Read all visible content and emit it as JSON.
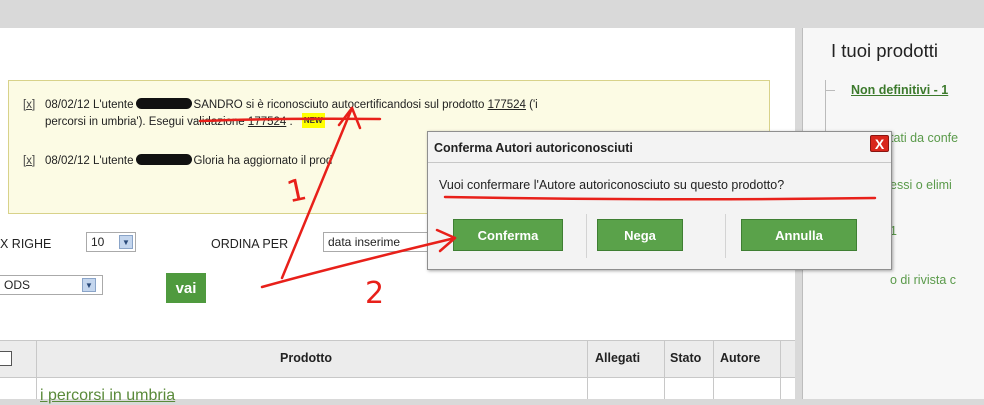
{
  "notices": [
    {
      "close": "[x]",
      "date": "08/02/12 L'utente",
      "text1": "SANDRO si è riconosciuto autocertificandosi sul prodotto",
      "link1": "177524",
      "text2": "('i",
      "line2_text": "percorsi in umbria'). Esegui validazione",
      "link2": "177524",
      "tail": ".",
      "badge": "NEW"
    },
    {
      "close": "[x]",
      "date": "08/02/12 L'utente",
      "text1": "Gloria ha aggiornato il prod"
    }
  ],
  "controls": {
    "max_rows_label": "X RIGHE",
    "max_rows_value": "10",
    "order_by_label": "ORDINA PER",
    "order_by_value": "data inserime",
    "format_value": "ODS",
    "go_button": "vai"
  },
  "table": {
    "headers": [
      "Prodotto",
      "Allegati",
      "Stato",
      "Autore"
    ],
    "rows": [
      {
        "prodotto": "i percorsi in umbria"
      }
    ]
  },
  "sidebar": {
    "title": "I tuoi prodotti",
    "items": [
      "Non definitivi - 1",
      "tati da confe",
      "essi o elimi",
      "1",
      "o di rivista c"
    ]
  },
  "dialog": {
    "title": "Conferma Autori autoriconosciuti",
    "close": "X",
    "message": "Vuoi confermare l'Autore autoriconosciuto su questo prodotto?",
    "buttons": {
      "confirm": "Conferma",
      "deny": "Nega",
      "cancel": "Annulla"
    }
  },
  "annotations": {
    "step1": "1",
    "step2": "2"
  },
  "colors": {
    "accent_green": "#5aa24a",
    "annotation_red": "#e8201a",
    "close_red": "#d9261c"
  }
}
